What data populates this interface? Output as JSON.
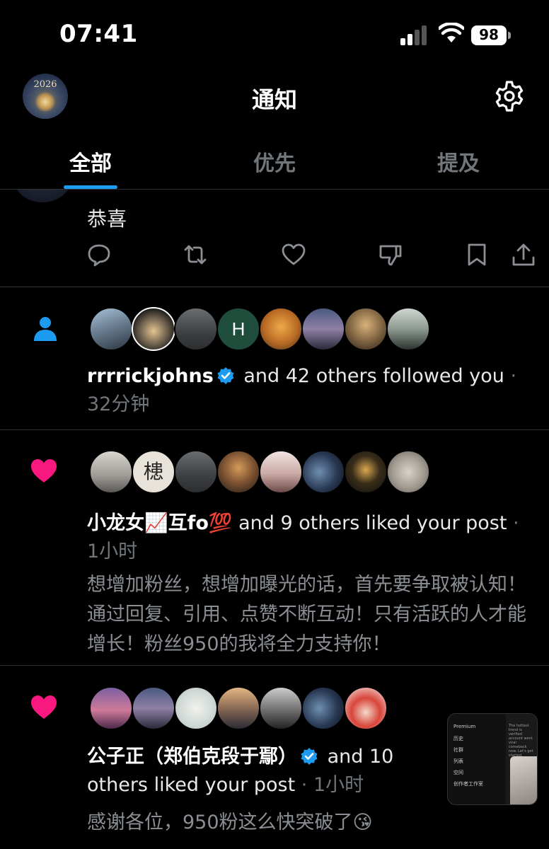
{
  "status_bar": {
    "time": "07:41",
    "battery": "98"
  },
  "header": {
    "title": "通知",
    "avatar_text": "2026"
  },
  "tabs": [
    {
      "label": "全部",
      "active": true
    },
    {
      "label": "优先",
      "active": false
    },
    {
      "label": "提及",
      "active": false
    }
  ],
  "partial_post": {
    "text": "恭喜"
  },
  "notifications": [
    {
      "type": "follow",
      "name": "rrrrickjohns",
      "verified": true,
      "rest": " and 42 others followed you",
      "time": " · 32分钟",
      "avatar_letter": "H"
    },
    {
      "type": "like",
      "name": "小龙女📈互fo💯",
      "verified": false,
      "rest": " and 9 others liked your post",
      "time": " · 1小时",
      "post_text": "想增加粉丝，想增加曝光的话，首先要争取被认知！通过回复、引用、点赞不断互动！只有活跃的人才能增长！粉丝950的我将全力支持你！"
    },
    {
      "type": "like",
      "name": "公子正（郑伯克段于鄢）",
      "verified": true,
      "rest": " and 10 others liked your post",
      "time": " · 1小时",
      "post_text": "感谢各位，950粉这么快突破了😘"
    }
  ],
  "pip": {
    "items": [
      "Premium",
      "历史",
      "社群",
      "列表",
      "空间",
      "创作者工作室"
    ],
    "right_text": "The hottest trend is verified account went viral comeback now. Let's get started."
  },
  "colors": {
    "accent": "#1d9bf0",
    "like": "#f91880",
    "follow_icon": "#1d9bf0",
    "background": "#000000"
  }
}
